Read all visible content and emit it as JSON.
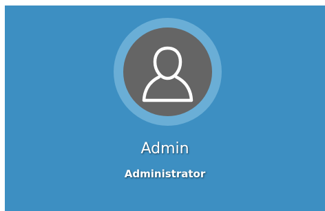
{
  "profile": {
    "name": "Admin",
    "role": "Administrator",
    "avatar_icon": "user-outline-icon"
  },
  "colors": {
    "panel_background": "#3d8fc2",
    "avatar_ring": "#6aaed6",
    "avatar_fill": "#656565",
    "text": "#ffffff"
  }
}
